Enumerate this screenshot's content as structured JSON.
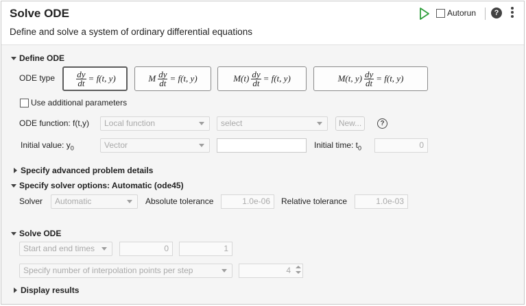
{
  "header": {
    "title": "Solve ODE",
    "subtitle": "Define and solve a system of ordinary differential equations",
    "autorun_label": "Autorun",
    "help_glyph": "?"
  },
  "define": {
    "section_label": "Define ODE",
    "ode_type_label": "ODE type",
    "ode_types": [
      {
        "pre": "",
        "n": "dy",
        "d": "dt",
        "rhs": "= f(t, y)"
      },
      {
        "pre": "M",
        "n": "dy",
        "d": "dt",
        "rhs": "= f(t, y)"
      },
      {
        "pre": "M(t)",
        "n": "dy",
        "d": "dt",
        "rhs": "= f(t, y)"
      },
      {
        "pre": "M(t, y)",
        "n": "dy",
        "d": "dt",
        "rhs": "= f(t, y)"
      }
    ],
    "use_params_label": "Use additional parameters",
    "ode_function_label": "ODE function: f(t,y)",
    "ode_function_value": "Local function",
    "ode_function_select": "select",
    "new_button": "New...",
    "initial_value_label": "Initial  value:  y",
    "initial_value_sub": "0",
    "initial_value_value": "Vector",
    "initial_value_field": "",
    "initial_time_label": "Initial  time:  t",
    "initial_time_sub": "0",
    "initial_time_value": "0"
  },
  "advanced": {
    "section_label": "Specify advanced problem details"
  },
  "solver_opts": {
    "section_label": "Specify solver options: Automatic (ode45)",
    "solver_label": "Solver",
    "solver_value": "Automatic",
    "abs_tol_label": "Absolute tolerance",
    "abs_tol_value": "1.0e-06",
    "rel_tol_label": "Relative tolerance",
    "rel_tol_value": "1.0e-03"
  },
  "solve": {
    "section_label": "Solve ODE",
    "time_mode": "Start and end times",
    "start_time": "0",
    "end_time": "1",
    "interp_mode": "Specify number of interpolation points per step",
    "interp_points": "4"
  },
  "display": {
    "section_label": "Display results"
  },
  "colors": {
    "run_green": "#2e9e3a",
    "panel_bg": "#f5f5f5",
    "header_bg": "#ffffff"
  }
}
